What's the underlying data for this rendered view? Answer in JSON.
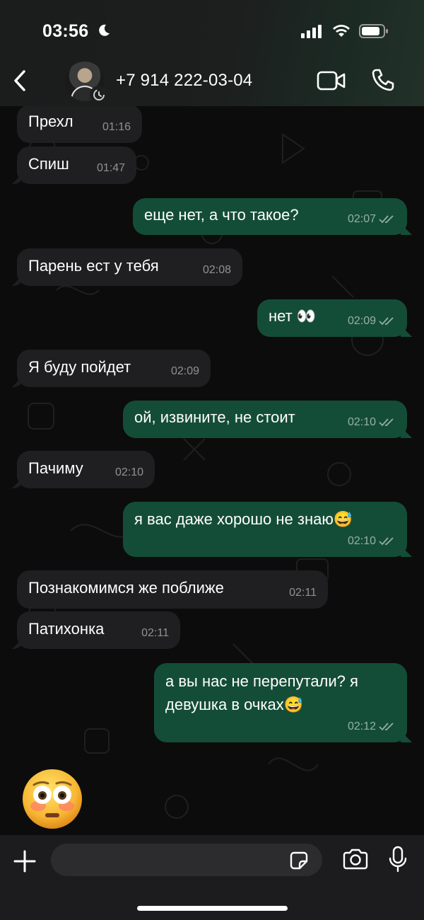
{
  "status_bar": {
    "time": "03:56"
  },
  "header": {
    "contact": "+7 914 222-03-04"
  },
  "messages": [
    {
      "text": "Прехл",
      "time": "01:16"
    },
    {
      "text": "Спиш",
      "time": "01:47"
    },
    {
      "text": "еще нет, а что такое?",
      "time": "02:07"
    },
    {
      "text": "Парень ест у тебя",
      "time": "02:08"
    },
    {
      "text": "нет 👀",
      "time": "02:09"
    },
    {
      "text": "Я буду пойдет",
      "time": "02:09"
    },
    {
      "text": "ой, извините, не стоит",
      "time": "02:10"
    },
    {
      "text": "Пачиму",
      "time": "02:10"
    },
    {
      "text": "я вас даже хорошо не знаю😅",
      "time": "02:10"
    },
    {
      "text": "Познакомимся же поближе",
      "time": "02:11"
    },
    {
      "text": "Патихонка",
      "time": "02:11"
    },
    {
      "text": "а вы нас не перепутали? я",
      "text2": "девушка в очках😅",
      "time": "02:12"
    }
  ],
  "composer": {
    "placeholder": ""
  },
  "colors": {
    "outgoing": "#144d37",
    "incoming": "#1f1f21",
    "background": "#0c0c0c"
  }
}
